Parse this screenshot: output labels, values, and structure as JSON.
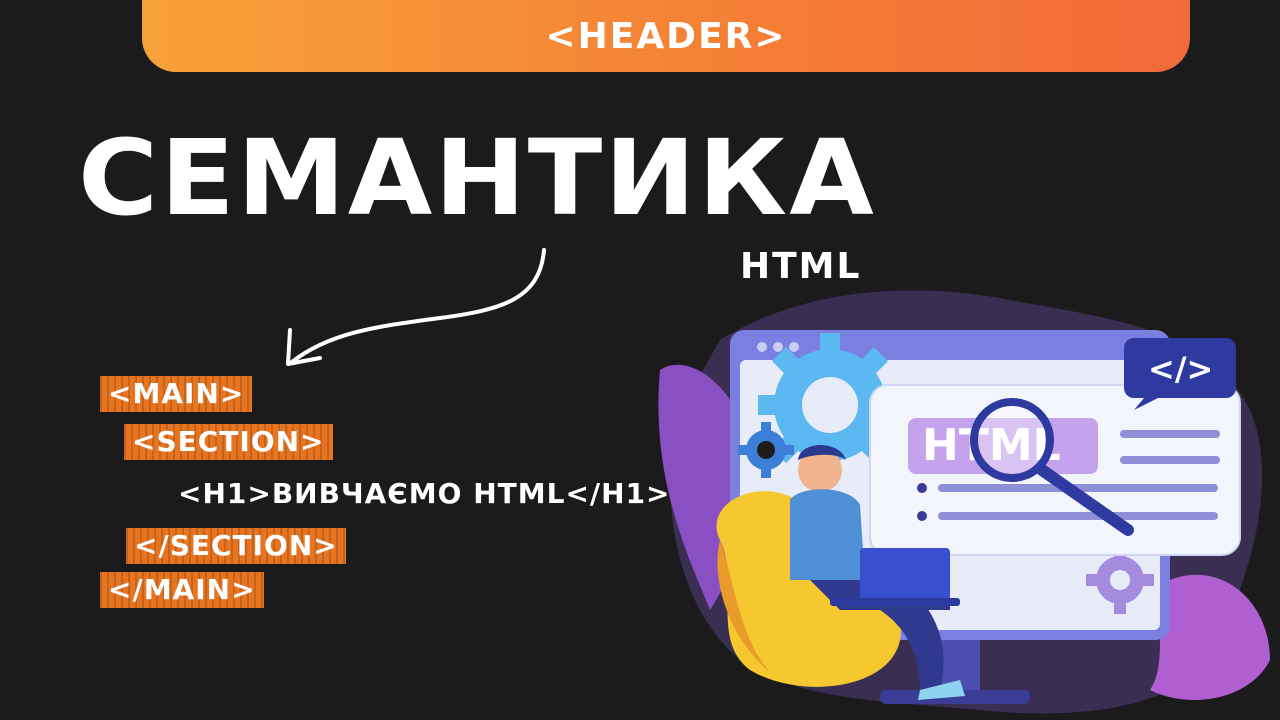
{
  "header": {
    "label": "<HEADER>"
  },
  "title": {
    "main": "СЕМАНТИКА",
    "sub": "HTML"
  },
  "code": {
    "main_open": "<MAIN>",
    "section_open": "<SECTION>",
    "h1_line": "<H1>ВИВЧАЄМО HTML</H1>",
    "section_close": "</SECTION>",
    "main_close": "</MAIN>"
  },
  "illustration": {
    "code_badge": "</>",
    "html_label": "HTML"
  },
  "colors": {
    "background": "#1b1b1b",
    "accent_orange": "#f47d35",
    "tag_orange": "#e8741f",
    "text": "#ffffff"
  }
}
